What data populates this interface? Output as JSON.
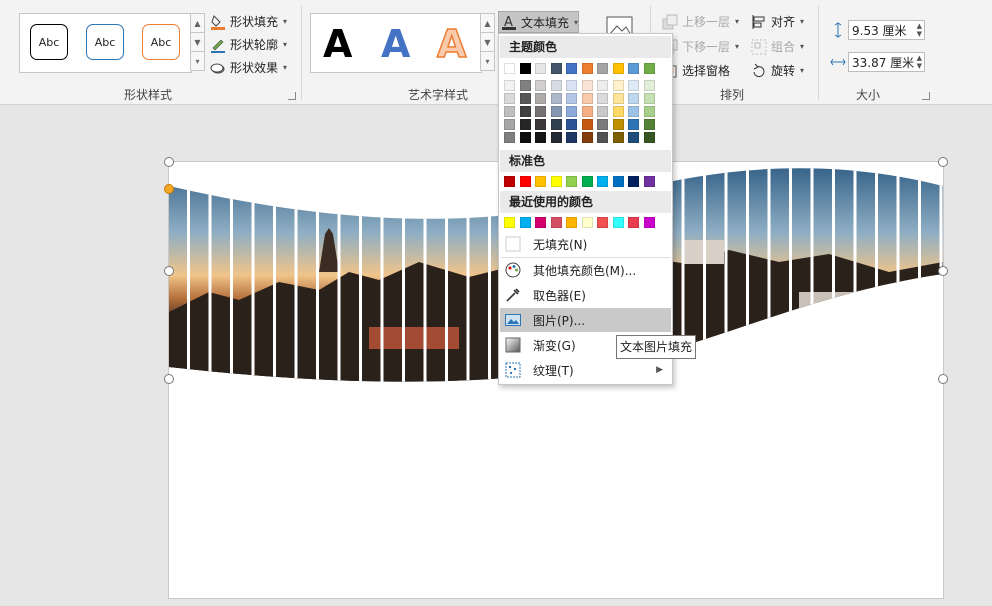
{
  "shape_styles": {
    "label": "形状样式",
    "samples": [
      {
        "text": "Abc",
        "border": "#000000"
      },
      {
        "text": "Abc",
        "border": "#2e75b6"
      },
      {
        "text": "Abc",
        "border": "#ed7d31"
      }
    ],
    "fill": "形状填充",
    "outline": "形状轮廓",
    "effect": "形状效果"
  },
  "wordart": {
    "label": "艺术字样式",
    "letters": [
      {
        "text": "A",
        "color": "#000000"
      },
      {
        "text": "A",
        "color": "#4472c4"
      },
      {
        "text": "A",
        "color": "#f4b183",
        "stroke": "#ed7d31"
      }
    ],
    "text_fill": "文本填充"
  },
  "arrange": {
    "label": "排列",
    "bring_forward": "上移一层",
    "send_backward": "下移一层",
    "selection_pane": "选择窗格",
    "align": "对齐",
    "group": "组合",
    "rotate": "旋转"
  },
  "size": {
    "label": "大小",
    "height": "9.53 厘米",
    "width": "33.87 厘米"
  },
  "fill_menu": {
    "theme_colors_label": "主题颜色",
    "theme_top": [
      "#ffffff",
      "#000000",
      "#e7e6e6",
      "#44546a",
      "#4472c4",
      "#ed7d31",
      "#a5a5a5",
      "#ffc000",
      "#5b9bd5",
      "#70ad47"
    ],
    "theme_shades": [
      [
        "#f2f2f2",
        "#808080",
        "#d0cece",
        "#d6dce4",
        "#d9e2f3",
        "#fbe4d5",
        "#ededed",
        "#fff2cc",
        "#deebf6",
        "#e2efd9"
      ],
      [
        "#d9d9d9",
        "#595959",
        "#aeabab",
        "#adb9ca",
        "#b4c6e7",
        "#f7caac",
        "#dbdbdb",
        "#fee599",
        "#bdd7ee",
        "#c5e0b3"
      ],
      [
        "#bfbfbf",
        "#404040",
        "#757171",
        "#8496b0",
        "#8eaadb",
        "#f4b183",
        "#c9c9c9",
        "#ffd965",
        "#9cc3e5",
        "#a8d08d"
      ],
      [
        "#a6a6a6",
        "#262626",
        "#3a3838",
        "#323f4f",
        "#2f5496",
        "#c55a11",
        "#7b7b7b",
        "#bf9000",
        "#2e75b5",
        "#538135"
      ],
      [
        "#7f7f7f",
        "#0d0d0d",
        "#171616",
        "#222a35",
        "#1f3864",
        "#833c0b",
        "#525252",
        "#7f6000",
        "#1e4e79",
        "#375623"
      ]
    ],
    "standard_label": "标准色",
    "standard": [
      "#c00000",
      "#ff0000",
      "#ffc000",
      "#ffff00",
      "#92d050",
      "#00b050",
      "#00b0f0",
      "#0070c0",
      "#002060",
      "#7030a0"
    ],
    "recent_label": "最近使用的颜色",
    "recent": [
      "#ffff00",
      "#00b0f0",
      "#d5006e",
      "#d45063",
      "#ffb400",
      "#ffffcc",
      "#f05050",
      "#33ffff",
      "#ea3c50",
      "#cc00cc"
    ],
    "no_fill": "无填充(N)",
    "more_colors": "其他填充颜色(M)...",
    "eyedropper": "取色器(E)",
    "picture": "图片(P)...",
    "gradient": "渐变(G)",
    "texture": "纹理(T)"
  },
  "tooltip": "文本图片填充"
}
